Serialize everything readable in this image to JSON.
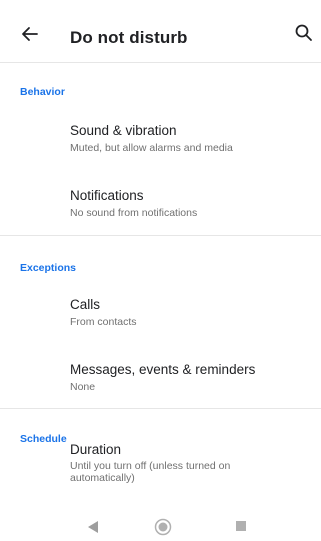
{
  "app_bar": {
    "title": "Do not disturb",
    "back_icon": "arrow-left-icon",
    "search_icon": "search-icon"
  },
  "sections": [
    {
      "header": "Behavior",
      "items": [
        {
          "title": "Sound & vibration",
          "subtitle": "Muted, but allow alarms and media"
        },
        {
          "title": "Notifications",
          "subtitle": "No sound from notifications"
        }
      ]
    },
    {
      "header": "Exceptions",
      "items": [
        {
          "title": "Calls",
          "subtitle": "From contacts"
        },
        {
          "title": "Messages, events & reminders",
          "subtitle": "None"
        }
      ]
    },
    {
      "header": "Schedule",
      "items": [
        {
          "title": "Duration",
          "subtitle": "Until you turn off (unless turned on automatically)"
        }
      ]
    }
  ],
  "nav_bar": {
    "back_icon": "nav-back-icon",
    "home_icon": "nav-home-icon",
    "recents_icon": "nav-recents-icon"
  },
  "colors": {
    "accent": "#1a73e8",
    "divider": "#e6e6e6",
    "secondary_text": "#707070"
  }
}
